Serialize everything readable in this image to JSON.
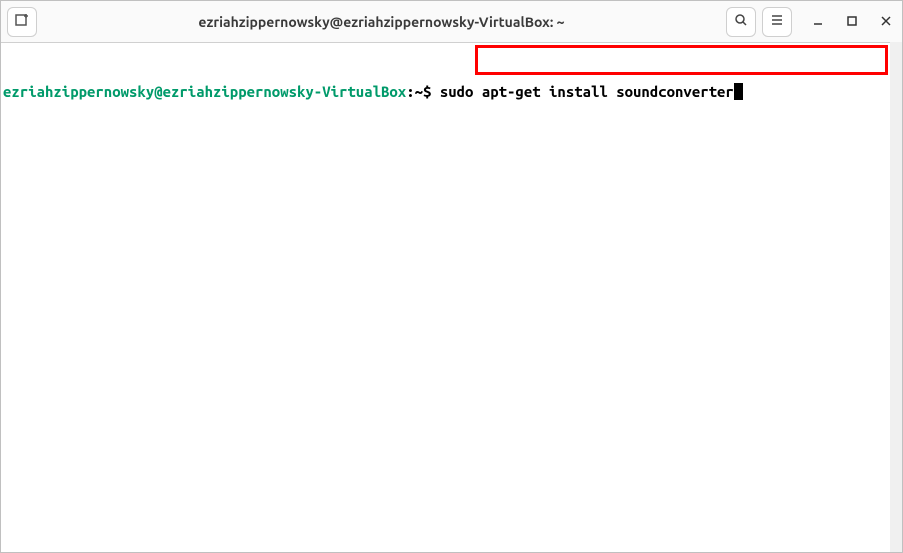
{
  "window": {
    "title": "ezriahzippernowsky@ezriahzippernowsky-VirtualBox: ~"
  },
  "titlebar": {
    "new_tab_icon": "new-tab-icon",
    "search_icon": "search-icon",
    "menu_icon": "menu-icon"
  },
  "terminal": {
    "prompt_user_host": "ezriahzippernowsky@ezriahzippernowsky-VirtualBox",
    "prompt_colon": ":",
    "prompt_path": "~",
    "prompt_symbol": "$ ",
    "command": "sudo apt-get install soundconverter"
  }
}
